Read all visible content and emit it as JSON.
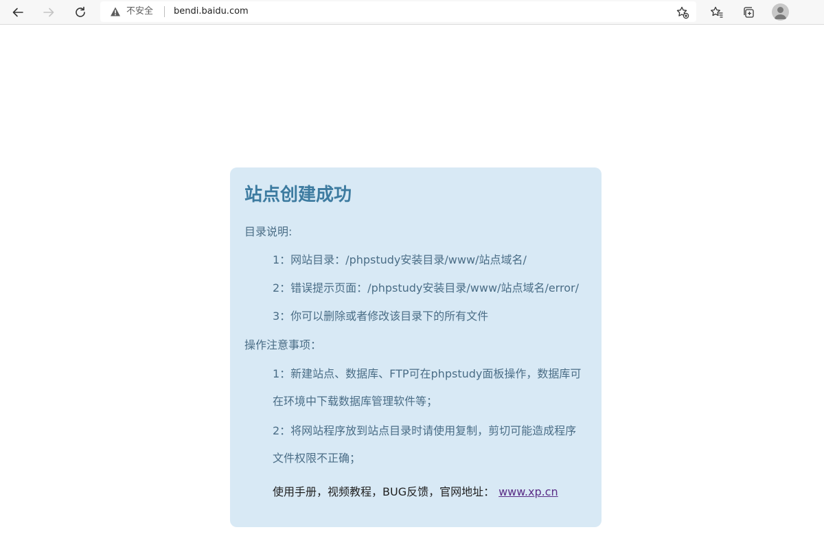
{
  "browser": {
    "security_label": "不安全",
    "url": "bendi.baidu.com",
    "icons": {
      "back": "arrow-left-icon",
      "forward": "arrow-right-icon",
      "refresh": "refresh-icon",
      "warning": "warning-triangle-icon",
      "add_favorite": "star-add-icon",
      "favorites": "favorites-icon",
      "collections": "collections-icon",
      "profile": "profile-avatar-icon"
    }
  },
  "card": {
    "title": "站点创建成功",
    "directory_heading": "目录说明:",
    "directory_items": [
      "1：网站目录：/phpstudy安装目录/www/站点域名/",
      "2：错误提示页面：/phpstudy安装目录/www/站点域名/error/",
      "3：你可以删除或者修改该目录下的所有文件"
    ],
    "notes_heading": "操作注意事项：",
    "note_lines": [
      "1：新建站点、数据库、FTP可在phpstudy面板操作，数据库可",
      "在环境中下载数据库管理软件等；",
      "2：将网站程序放到站点目录时请使用复制，剪切可能造成程序",
      "文件权限不正确；"
    ],
    "resources_text": "使用手册，视频教程，BUG反馈，官网地址：",
    "resources_link": "www.xp.cn",
    "colors": {
      "background": "#d8e9f5",
      "title": "#3d7ba0",
      "text": "#4a6d86",
      "link": "#5a2d86"
    }
  }
}
